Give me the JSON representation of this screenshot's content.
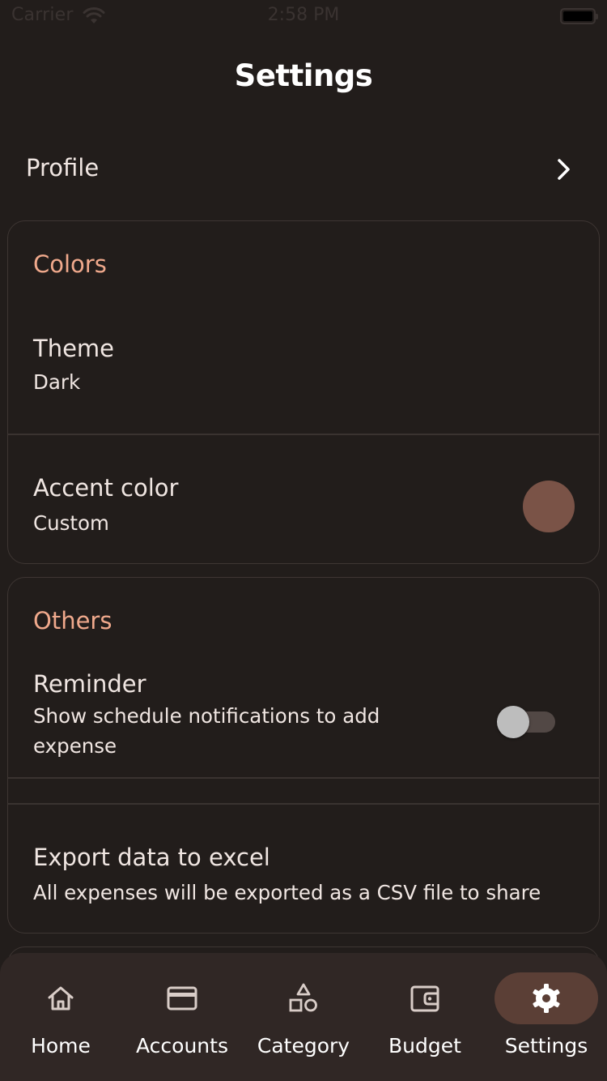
{
  "status_bar": {
    "carrier": "Carrier",
    "time": "2:58 PM"
  },
  "header": {
    "title": "Settings"
  },
  "profile": {
    "label": "Profile"
  },
  "colors_section": {
    "heading": "Colors",
    "theme": {
      "title": "Theme",
      "value": "Dark"
    },
    "accent": {
      "title": "Accent color",
      "value": "Custom",
      "swatch_color": "#7a5347"
    }
  },
  "others_section": {
    "heading": "Others",
    "reminder": {
      "title": "Reminder",
      "description_line1": "Show schedule notifications to add",
      "description_line2": "expense",
      "enabled": false
    },
    "export": {
      "title": "Export data to excel",
      "description": "All expenses will be exported as a CSV file to share"
    }
  },
  "bottom_nav": {
    "items": [
      {
        "label": "Home",
        "icon": "home-icon",
        "active": false
      },
      {
        "label": "Accounts",
        "icon": "credit-card-icon",
        "active": false
      },
      {
        "label": "Category",
        "icon": "shapes-icon",
        "active": false
      },
      {
        "label": "Budget",
        "icon": "wallet-icon",
        "active": false
      },
      {
        "label": "Settings",
        "icon": "gear-icon",
        "active": true
      }
    ]
  },
  "colors": {
    "background": "#221d1b",
    "section_heading": "#f0a98c",
    "nav_background": "#302725",
    "nav_active_pill": "#5b3f36"
  }
}
